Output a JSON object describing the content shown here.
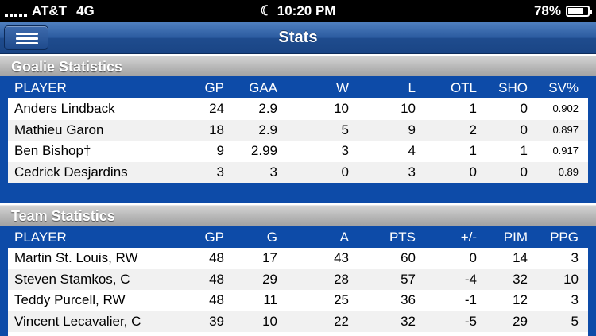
{
  "status_bar": {
    "carrier": "AT&T",
    "network": "4G",
    "time": "10:20 PM",
    "battery_percent": "78%",
    "battery_level": 0.78
  },
  "nav": {
    "title": "Stats",
    "menu_icon": "hamburger-menu-icon"
  },
  "goalie": {
    "section_title": "Goalie Statistics",
    "columns": [
      "PLAYER",
      "GP",
      "GAA",
      "W",
      "L",
      "OTL",
      "SHO",
      "SV%"
    ],
    "rows": [
      [
        "Anders Lindback",
        "24",
        "2.9",
        "10",
        "10",
        "1",
        "0",
        "0.902"
      ],
      [
        "Mathieu Garon",
        "18",
        "2.9",
        "5",
        "9",
        "2",
        "0",
        "0.897"
      ],
      [
        "Ben Bishop†",
        "9",
        "2.99",
        "3",
        "4",
        "1",
        "1",
        "0.917"
      ],
      [
        "Cedrick Desjardins",
        "3",
        "3",
        "0",
        "3",
        "0",
        "0",
        "0.89"
      ]
    ]
  },
  "team": {
    "section_title": "Team Statistics",
    "columns": [
      "PLAYER",
      "GP",
      "G",
      "A",
      "PTS",
      "+/-",
      "PIM",
      "PPG"
    ],
    "rows": [
      [
        "Martin St. Louis, RW",
        "48",
        "17",
        "43",
        "60",
        "0",
        "14",
        "3"
      ],
      [
        "Steven Stamkos, C",
        "48",
        "29",
        "28",
        "57",
        "-4",
        "32",
        "10"
      ],
      [
        "Teddy Purcell, RW",
        "48",
        "11",
        "25",
        "36",
        "-1",
        "12",
        "3"
      ],
      [
        "Vincent Lecavalier, C",
        "39",
        "10",
        "22",
        "32",
        "-5",
        "29",
        "5"
      ]
    ]
  },
  "colors": {
    "panel_blue": "#0d4ba8",
    "nav_blue": "#2a5a9f",
    "row_alt": "#f1f1f1"
  }
}
